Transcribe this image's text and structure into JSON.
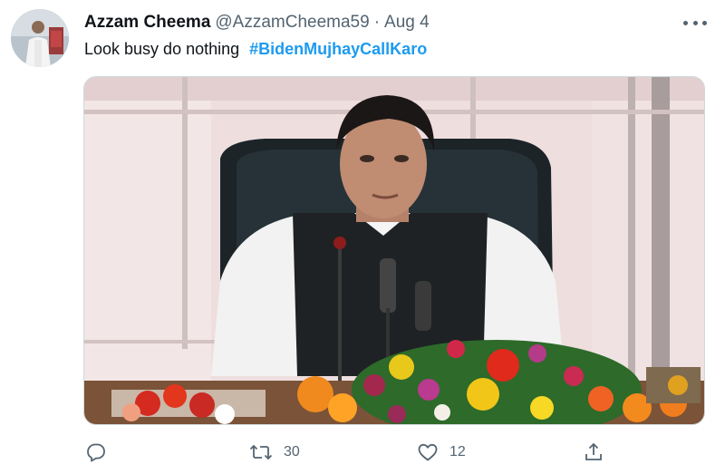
{
  "tweet": {
    "display_name": "Azzam Cheema",
    "handle": "@AzzamCheema59",
    "separator": "·",
    "date": "Aug 4",
    "text": "Look busy do nothing",
    "hashtag": "#BidenMujhayCallKaro",
    "more_icon": "more-horizontal-icon"
  },
  "actions": {
    "reply": {
      "icon": "reply-icon",
      "count": ""
    },
    "retweet": {
      "icon": "retweet-icon",
      "count": "30"
    },
    "like": {
      "icon": "heart-icon",
      "count": "12"
    },
    "share": {
      "icon": "share-icon",
      "count": ""
    }
  },
  "colors": {
    "accent": "#1d9bf0",
    "secondary_text": "#536471",
    "primary_text": "#0f1419"
  }
}
